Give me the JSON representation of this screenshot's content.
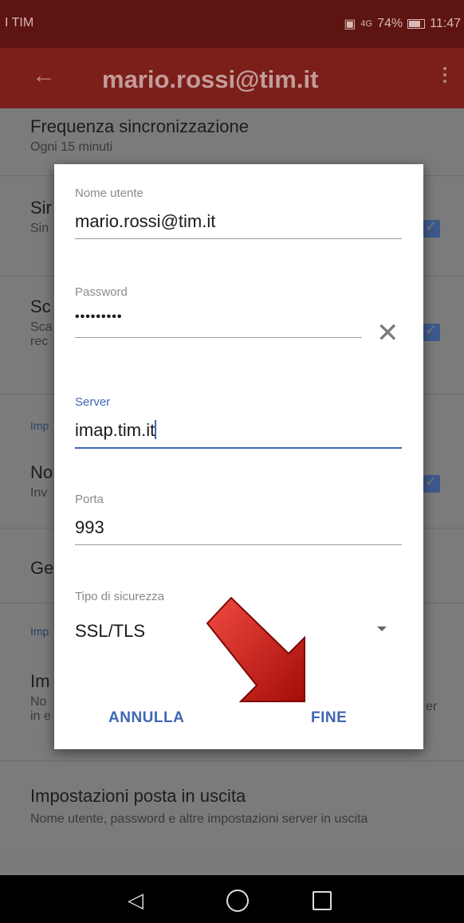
{
  "statusbar": {
    "carrier": "I TIM",
    "signal": "4G",
    "battery": "74%",
    "time": "11:47"
  },
  "appbar": {
    "title": "mario.rossi@tim.it",
    "back_icon": "arrow-left-icon",
    "more_icon": "more-vert-icon"
  },
  "settings": {
    "sync_freq": {
      "title": "Frequenza sincronizzazione",
      "subtitle": "Ogni 15 minuti"
    },
    "row2": {
      "title": "Sir",
      "subtitle": "Sin"
    },
    "row3": {
      "title": "Sc",
      "subtitle1": "Sca",
      "subtitle2": "rec"
    },
    "section1": "Imp",
    "row4": {
      "title": "No",
      "subtitle": "Inv"
    },
    "row5": {
      "title": "Ge"
    },
    "section2": "Imp",
    "row6": {
      "title": "Im",
      "subtitle1": "No",
      "subtitle2": "in e",
      "trail": "er"
    },
    "outgoing": {
      "title": "Impostazioni posta in uscita",
      "subtitle": "Nome utente, password e altre impostazioni server in uscita"
    }
  },
  "dialog": {
    "username": {
      "label": "Nome utente",
      "value": "mario.rossi@tim.it"
    },
    "password": {
      "label": "Password",
      "value": "•••••••••"
    },
    "server": {
      "label": "Server",
      "value": "imap.tim.it"
    },
    "port": {
      "label": "Porta",
      "value": "993"
    },
    "security": {
      "label": "Tipo di sicurezza",
      "value": "SSL/TLS"
    },
    "cancel_label": "ANNULLA",
    "done_label": "FINE"
  },
  "colors": {
    "appbar": "#7c1f1a",
    "accent": "#3f67b2",
    "arrow": "#d01a14"
  }
}
